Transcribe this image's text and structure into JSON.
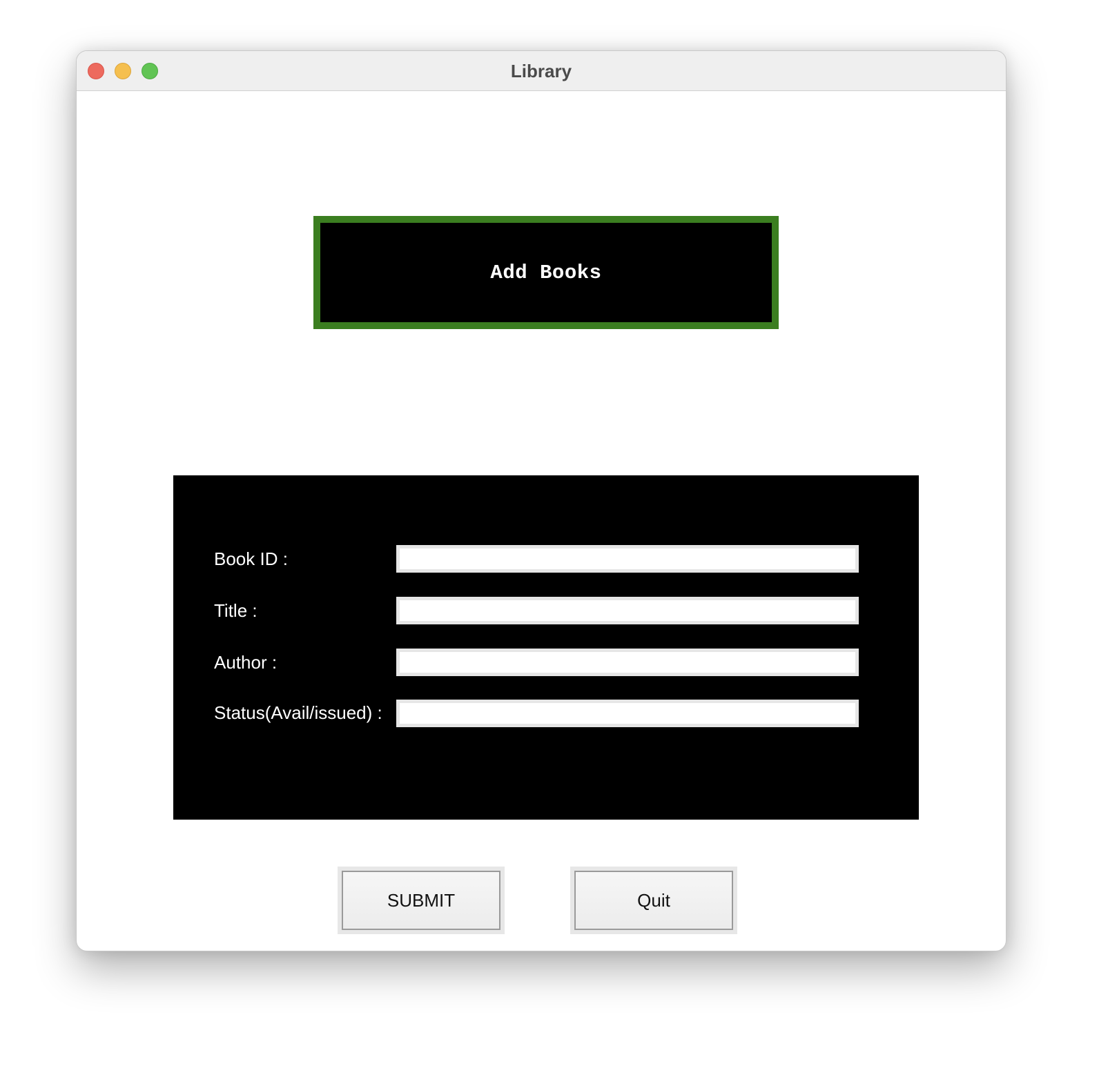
{
  "window": {
    "title": "Library"
  },
  "header": {
    "heading": "Add Books",
    "border_color": "#3b7e20"
  },
  "form": {
    "fields": [
      {
        "label": "Book ID :",
        "value": ""
      },
      {
        "label": "Title :",
        "value": ""
      },
      {
        "label": "Author :",
        "value": ""
      },
      {
        "label": "Status(Avail/issued) :",
        "value": ""
      }
    ]
  },
  "buttons": {
    "submit_label": "SUBMIT",
    "quit_label": "Quit"
  }
}
